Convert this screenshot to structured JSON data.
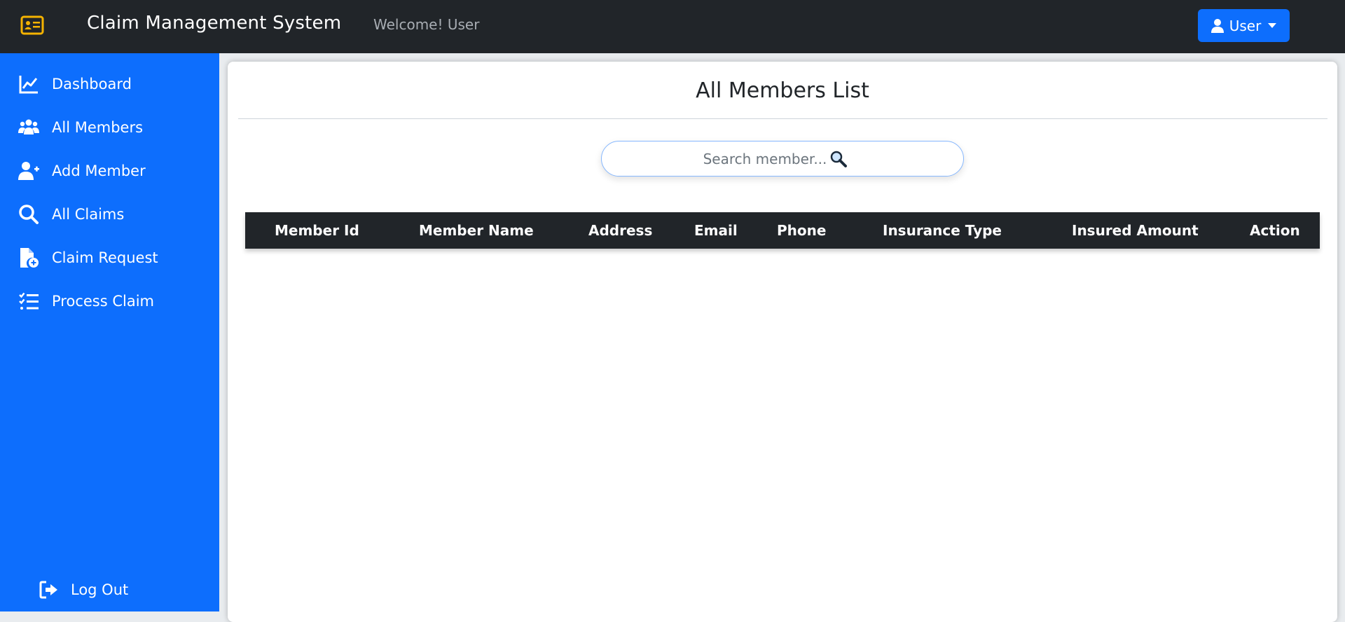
{
  "navbar": {
    "title": "Claim Management System",
    "welcome": "Welcome! User",
    "user_button": "User"
  },
  "sidebar": {
    "items": [
      {
        "label": "Dashboard",
        "icon": "chart-line-icon"
      },
      {
        "label": "All Members",
        "icon": "users-icon"
      },
      {
        "label": "Add Member",
        "icon": "user-plus-icon"
      },
      {
        "label": "All Claims",
        "icon": "search-icon"
      },
      {
        "label": "Claim Request",
        "icon": "file-add-icon"
      },
      {
        "label": "Process Claim",
        "icon": "list-check-icon"
      }
    ],
    "logout": "Log Out"
  },
  "main": {
    "title": "All Members List",
    "search": {
      "placeholder": "Search member...",
      "value": ""
    },
    "table": {
      "headers": [
        "Member Id",
        "Member Name",
        "Address",
        "Email",
        "Phone",
        "Insurance Type",
        "Insured Amount",
        "Action"
      ],
      "rows": []
    }
  },
  "colors": {
    "navbar": "#212529",
    "sidebar": "#0d6efd",
    "accent": "#0d6efd",
    "brand_icon": "#f5b301",
    "table_header": "#212529"
  }
}
